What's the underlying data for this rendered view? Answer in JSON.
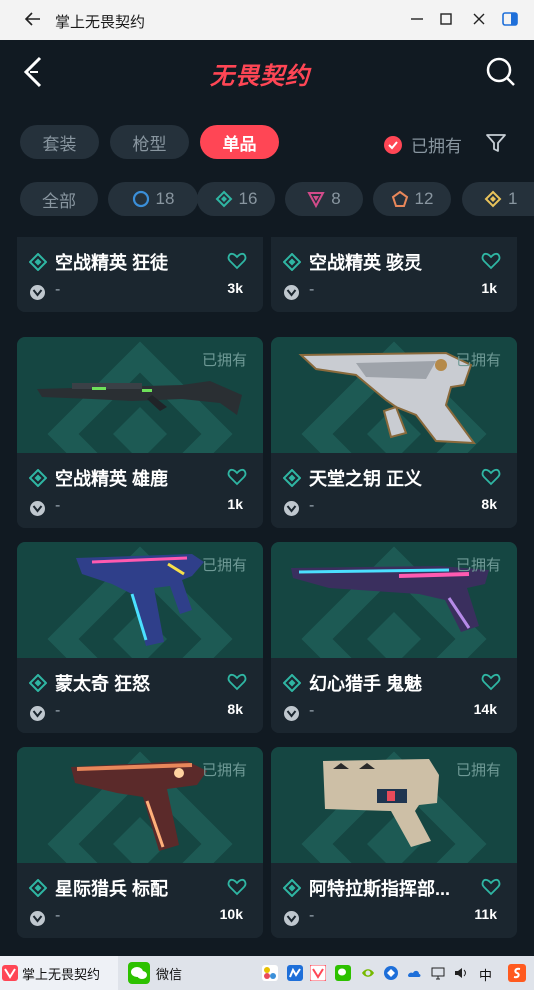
{
  "window": {
    "title": "掌上无畏契约"
  },
  "header": {
    "logo_text": "无畏契约"
  },
  "tabs": [
    {
      "label": "套装",
      "active": false
    },
    {
      "label": "枪型",
      "active": false
    },
    {
      "label": "单品",
      "active": true
    }
  ],
  "owned_filter": {
    "label": "已拥有",
    "checked": true
  },
  "tier_chips": [
    {
      "label": "全部",
      "icon": "none"
    },
    {
      "label": "18",
      "icon": "select-tier-icon",
      "color": "#3b8fd9"
    },
    {
      "label": "16",
      "icon": "deluxe-tier-icon",
      "color": "#2fb6a3"
    },
    {
      "label": "8",
      "icon": "premium-tier-icon",
      "color": "#d24b8a"
    },
    {
      "label": "12",
      "icon": "exclusive-tier-icon",
      "color": "#e8875a"
    },
    {
      "label": "1",
      "icon": "ultra-tier-icon",
      "color": "#e9c35b"
    }
  ],
  "cards": [
    {
      "name": "空战精英 狂徒",
      "price": "-",
      "count": "3k",
      "owned_label": "",
      "gun": "rifle"
    },
    {
      "name": "空战精英 骇灵",
      "price": "-",
      "count": "1k",
      "owned_label": "",
      "gun": "rifle"
    },
    {
      "name": "空战精英 雄鹿",
      "price": "-",
      "count": "1k",
      "owned_label": "已拥有",
      "gun": "shotgun"
    },
    {
      "name": "天堂之钥 正义",
      "price": "-",
      "count": "8k",
      "owned_label": "已拥有",
      "gun": "revolver"
    },
    {
      "name": "蒙太奇 狂怒",
      "price": "-",
      "count": "8k",
      "owned_label": "已拥有",
      "gun": "frenzy"
    },
    {
      "name": "幻心猎手 鬼魅",
      "price": "-",
      "count": "14k",
      "owned_label": "已拥有",
      "gun": "ghost"
    },
    {
      "name": "星际猎兵 标配",
      "price": "-",
      "count": "10k",
      "owned_label": "已拥有",
      "gun": "classic"
    },
    {
      "name": "阿特拉斯指挥部...",
      "price": "-",
      "count": "11k",
      "owned_label": "已拥有",
      "gun": "shorty"
    }
  ],
  "taskbar": {
    "apps": [
      {
        "label": "掌上无畏契约",
        "active": true
      },
      {
        "label": "微信",
        "active": false
      }
    ],
    "ime_label": "中"
  },
  "colors": {
    "accent": "#ff4655",
    "card_art": "#154642",
    "tier_teal": "#2fb6a3"
  }
}
